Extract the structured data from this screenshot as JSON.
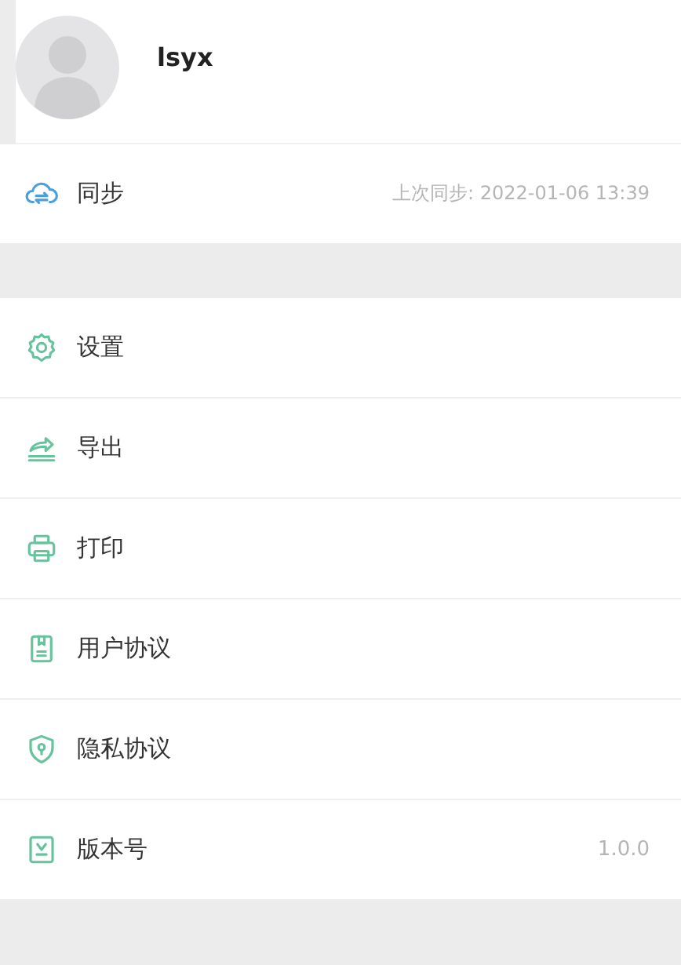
{
  "profile": {
    "username": "lsyx"
  },
  "sync": {
    "label": "同步",
    "last_sync": "上次同步: 2022-01-06 13:39"
  },
  "menu": [
    {
      "kind": "settings",
      "label": "设置"
    },
    {
      "kind": "export",
      "label": "导出"
    },
    {
      "kind": "print",
      "label": "打印"
    },
    {
      "kind": "agreement",
      "label": "用户协议"
    },
    {
      "kind": "privacy",
      "label": "隐私协议"
    },
    {
      "kind": "version",
      "label": "版本号",
      "value": "1.0.0"
    }
  ]
}
